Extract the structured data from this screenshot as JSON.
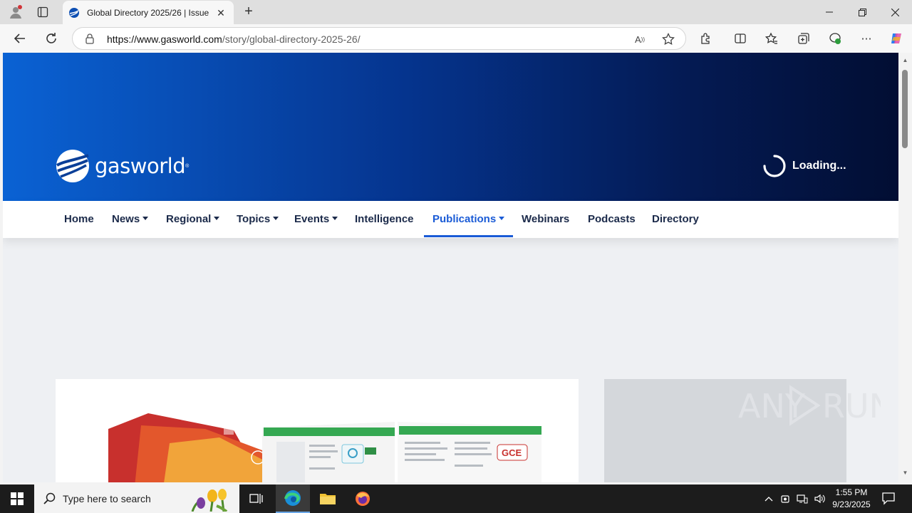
{
  "browser": {
    "tab_title": "Global Directory 2025/26 | Issue",
    "url_host": "https://www.gasworld.com",
    "url_path": "/story/global-directory-2025-26/",
    "new_tab_label": "+"
  },
  "site": {
    "logo_text": "gasworld",
    "logo_mark": "®",
    "loading_text": "Loading...",
    "nav": [
      {
        "label": "Home"
      },
      {
        "label": "News"
      },
      {
        "label": "Regional"
      },
      {
        "label": "Topics"
      },
      {
        "label": "Events"
      },
      {
        "label": "Intelligence"
      },
      {
        "label": "Publications"
      },
      {
        "label": "Webinars"
      },
      {
        "label": "Podcasts"
      },
      {
        "label": "Directory"
      }
    ],
    "active_nav": "Publications",
    "brand_color": "#1a5bd6"
  },
  "watermark": "ANY RUN",
  "taskbar": {
    "search_placeholder": "Type here to search",
    "time": "1:55 PM",
    "date": "9/23/2025"
  }
}
